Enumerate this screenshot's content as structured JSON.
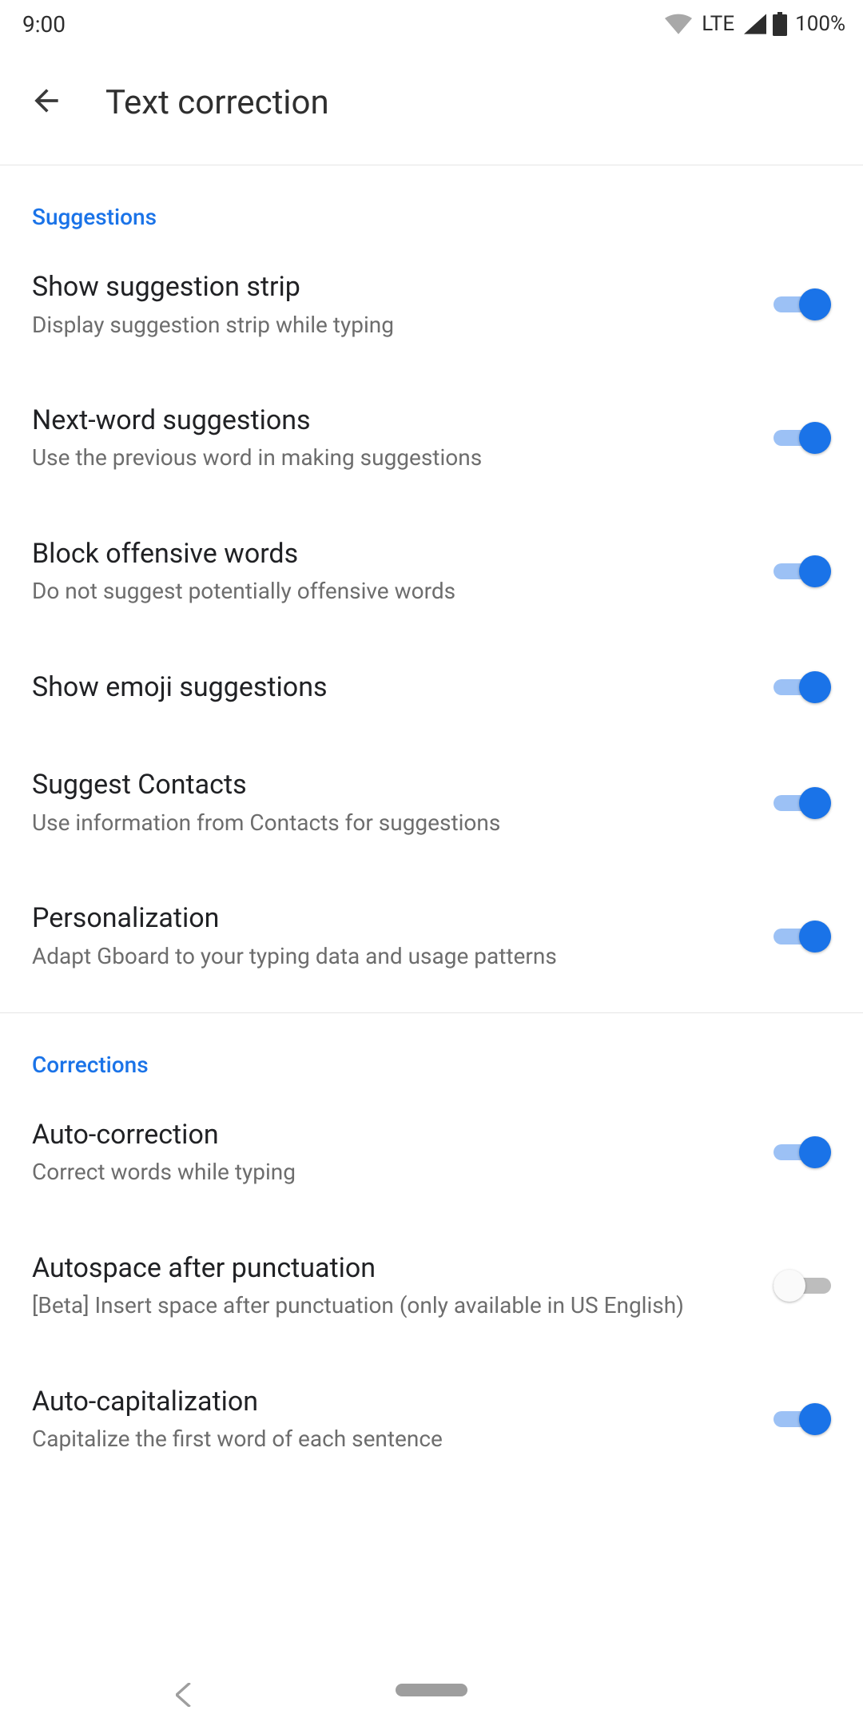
{
  "status": {
    "time": "9:00",
    "lte": "LTE",
    "battery": "100%"
  },
  "header": {
    "title": "Text correction"
  },
  "sections": {
    "suggestions": {
      "label": "Suggestions"
    },
    "corrections": {
      "label": "Corrections"
    }
  },
  "items": {
    "show_strip": {
      "title": "Show suggestion strip",
      "sub": "Display suggestion strip while typing",
      "on": true
    },
    "next_word": {
      "title": "Next-word suggestions",
      "sub": "Use the previous word in making suggestions",
      "on": true
    },
    "block_off": {
      "title": "Block offensive words",
      "sub": "Do not suggest potentially offensive words",
      "on": true
    },
    "emoji": {
      "title": "Show emoji suggestions",
      "sub": "",
      "on": true
    },
    "contacts": {
      "title": "Suggest Contacts",
      "sub": "Use information from Contacts for suggestions",
      "on": true
    },
    "personal": {
      "title": "Personalization",
      "sub": "Adapt Gboard to your typing data and usage patterns",
      "on": true
    },
    "autocorrect": {
      "title": "Auto-correction",
      "sub": "Correct words while typing",
      "on": true
    },
    "autospace": {
      "title": "Autospace after punctuation",
      "sub": "[Beta] Insert space after punctuation (only available in US English)",
      "on": false
    },
    "autocap": {
      "title": "Auto-capitalization",
      "sub": "Capitalize the first word of each sentence",
      "on": true
    }
  }
}
